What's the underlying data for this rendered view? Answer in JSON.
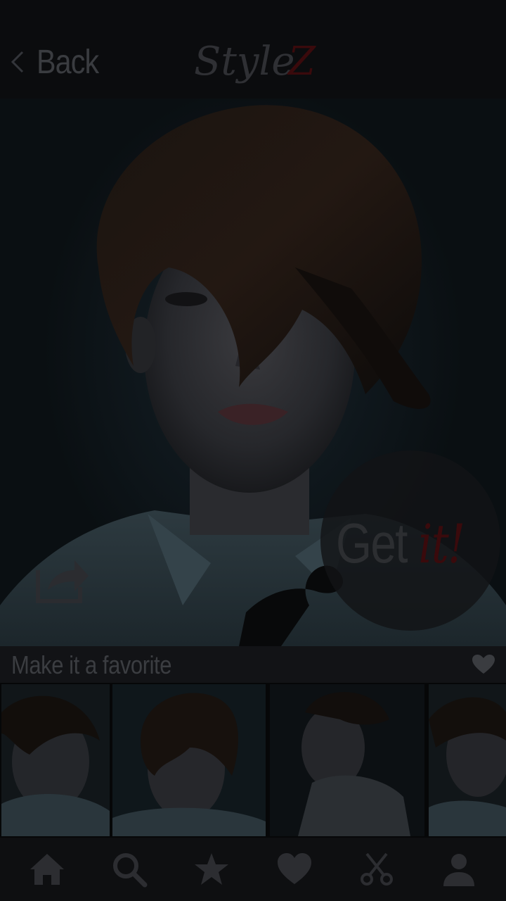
{
  "header": {
    "back_label": "Back",
    "logo_text": "Style",
    "logo_accent": "Z"
  },
  "hero": {
    "image": "hairstyle-model-photo",
    "share_icon": "share-icon",
    "getit_label": "Get ",
    "getit_accent": "it!"
  },
  "favorite": {
    "label": "Make it a favorite",
    "icon": "heart-icon"
  },
  "thumbnails": [
    {
      "name": "thumbnail-1",
      "image": "side-profile-short-haircut"
    },
    {
      "name": "thumbnail-2",
      "image": "front-fringe-haircut"
    },
    {
      "name": "thumbnail-3",
      "image": "undercut-side-profile"
    },
    {
      "name": "thumbnail-4",
      "image": "side-profile-pixie-cut"
    }
  ],
  "nav": {
    "items": [
      {
        "name": "home",
        "icon": "home-icon"
      },
      {
        "name": "search",
        "icon": "search-icon"
      },
      {
        "name": "featured",
        "icon": "star-icon"
      },
      {
        "name": "favorites",
        "icon": "heart-icon"
      },
      {
        "name": "salons",
        "icon": "scissors-icon"
      },
      {
        "name": "profile",
        "icon": "user-icon"
      }
    ]
  },
  "colors": {
    "background": "#0c0d0f",
    "text_dim": "#3a3c40",
    "accent_red": "#3a0a0c"
  }
}
